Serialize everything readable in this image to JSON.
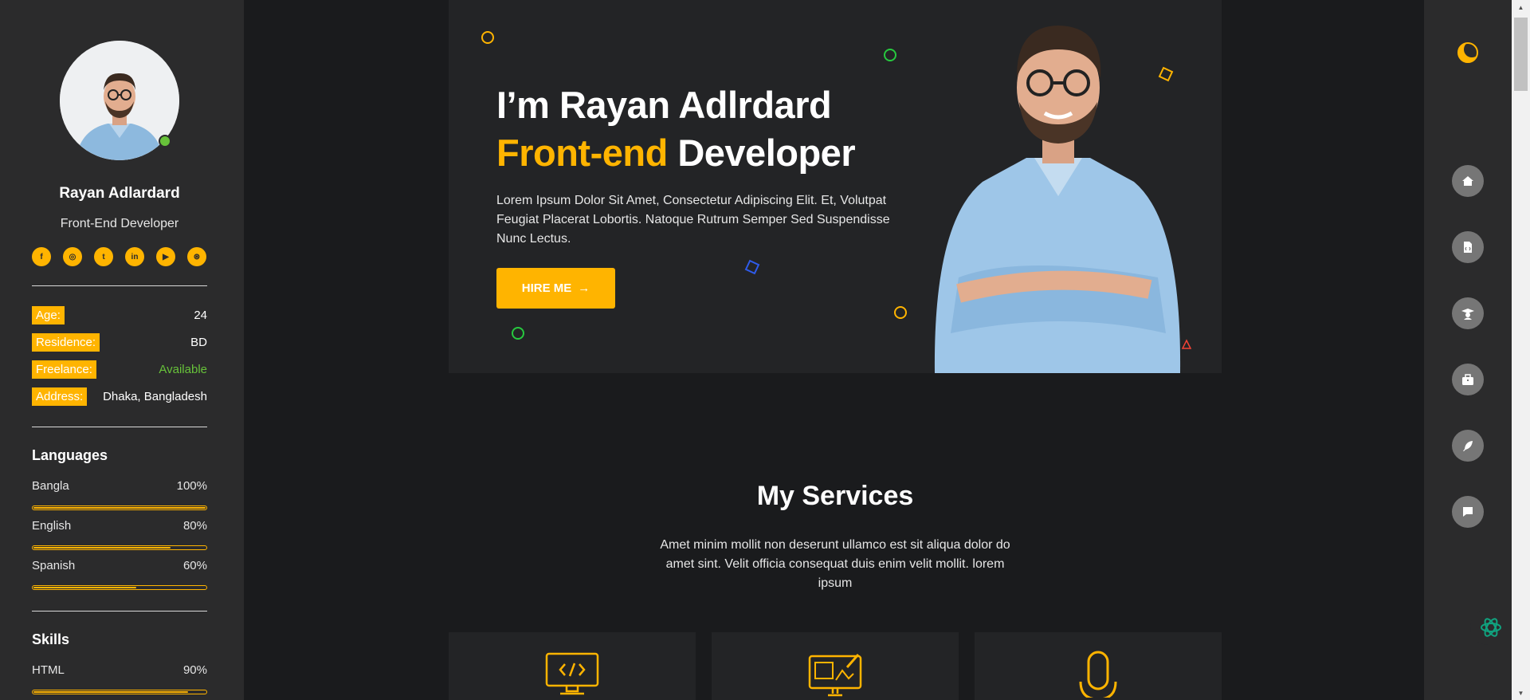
{
  "profile": {
    "name": "Rayan Adlardard",
    "role": "Front-End Developer",
    "status_color": "#67c23a"
  },
  "socials": [
    {
      "icon": "facebook-icon",
      "glyph": "f"
    },
    {
      "icon": "instagram-icon",
      "glyph": "◎"
    },
    {
      "icon": "twitter-icon",
      "glyph": "t"
    },
    {
      "icon": "linkedin-icon",
      "glyph": "in"
    },
    {
      "icon": "youtube-icon",
      "glyph": "▶"
    },
    {
      "icon": "dribbble-icon",
      "glyph": "⊛"
    }
  ],
  "info": {
    "age_label": "Age:",
    "age_value": "24",
    "residence_label": "Residence:",
    "residence_value": "BD",
    "freelance_label": "Freelance:",
    "freelance_value": "Available",
    "address_label": "Address:",
    "address_value": "Dhaka, Bangladesh"
  },
  "languages": {
    "title": "Languages",
    "items": [
      {
        "name": "Bangla",
        "percent_label": "100%",
        "level": 100
      },
      {
        "name": "English",
        "percent_label": "80%",
        "level": 80
      },
      {
        "name": "Spanish",
        "percent_label": "60%",
        "level": 60
      }
    ]
  },
  "skills": {
    "title": "Skills",
    "items": [
      {
        "name": "HTML",
        "percent_label": "90%",
        "level": 90
      }
    ]
  },
  "hero": {
    "title_line1": "I’m Rayan Adlrdard",
    "title_accent": "Front-end",
    "title_rest": " Developer",
    "description": "Lorem Ipsum Dolor Sit Amet, Consectetur Adipiscing Elit. Et, Volutpat Feugiat Placerat Lobortis. Natoque Rutrum Semper Sed Suspendisse Nunc Lectus.",
    "hire_label": "HIRE ME",
    "hire_arrow": "→"
  },
  "services": {
    "title": "My Services",
    "description": "Amet minim mollit non deserunt ullamco est sit aliqua dolor do amet sint. Velit officia consequat duis enim velit mollit. lorem ipsum",
    "cards": [
      {
        "icon": "code-monitor-icon"
      },
      {
        "icon": "design-monitor-icon"
      },
      {
        "icon": "microphone-icon"
      }
    ]
  },
  "nav": {
    "theme_icon": "moon-icon",
    "items": [
      {
        "icon": "home-icon"
      },
      {
        "icon": "code-file-icon"
      },
      {
        "icon": "graduation-icon"
      },
      {
        "icon": "briefcase-icon"
      },
      {
        "icon": "feather-icon"
      },
      {
        "icon": "chat-icon"
      }
    ]
  },
  "colors": {
    "accent": "#ffb400",
    "sidebar_bg": "#2b2b2c",
    "page_bg": "#1a1b1d",
    "card_bg": "#232426",
    "available": "#67c23a"
  }
}
